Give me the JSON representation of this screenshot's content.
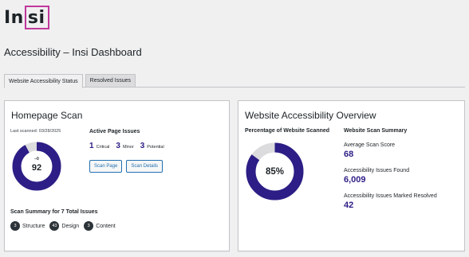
{
  "logo": {
    "text_left": "In",
    "text_boxed": "si",
    "box_color": "#c0399b"
  },
  "page_title": "Accessibility – Insi Dashboard",
  "tabs": [
    {
      "label": "Website Accessibility Status",
      "active": true
    },
    {
      "label": "Resolved Issues",
      "active": false
    }
  ],
  "homepage_scan": {
    "title": "Homepage Scan",
    "last_scanned": "Last scanned: 03/28/2025",
    "score": "92",
    "score_delta": "−0",
    "score_fraction": 0.92,
    "ring_color": "#2c1e86",
    "ring_track_color": "#dcdcde",
    "active_issues": {
      "heading": "Active Page Issues",
      "items": [
        {
          "count": "1",
          "label": "Critical"
        },
        {
          "count": "3",
          "label": "Minor"
        },
        {
          "count": "3",
          "label": "Potential"
        }
      ]
    },
    "buttons": {
      "scan_page": "Scan Page",
      "scan_details": "Scan Details"
    },
    "summary": {
      "heading": "Scan Summary for 7 Total Issues",
      "items": [
        {
          "count": "3",
          "label": "Structure"
        },
        {
          "count": "43",
          "label": "Design"
        },
        {
          "count": "3",
          "label": "Content"
        }
      ]
    }
  },
  "overview": {
    "title": "Website Accessibility Overview",
    "pct_label": "Percentage of Website Scanned",
    "pct_value": "85%",
    "pct_fraction": 0.85,
    "summary_heading": "Website Scan Summary",
    "stats": [
      {
        "label": "Average Scan Score",
        "value": "68"
      },
      {
        "label": "Accessibility Issues Found",
        "value": "6,009"
      },
      {
        "label": "Accessibility Issues Marked Resolved",
        "value": "42"
      }
    ]
  }
}
